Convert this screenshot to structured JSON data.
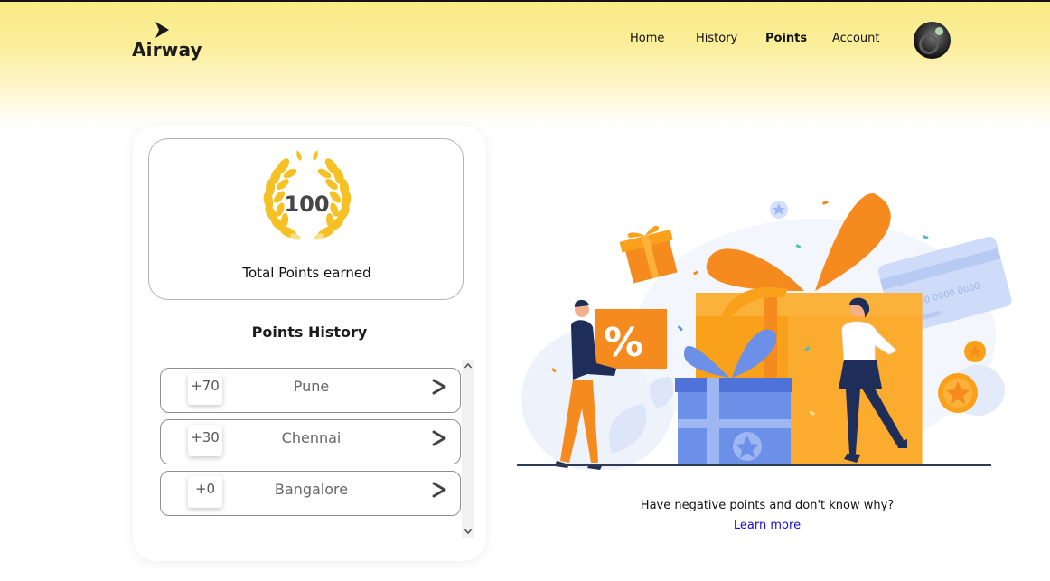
{
  "header": {
    "logo_text": "Airway",
    "nav": [
      {
        "label": "Home",
        "active": false
      },
      {
        "label": "History",
        "active": false
      },
      {
        "label": "Points",
        "active": true
      },
      {
        "label": "Account",
        "active": false
      }
    ]
  },
  "points_card": {
    "total_points": "100",
    "total_label": "Total Points earned",
    "history_title": "Points History",
    "history": [
      {
        "points": "+70",
        "city": "Pune"
      },
      {
        "points": "+30",
        "city": "Chennai"
      },
      {
        "points": "+0",
        "city": "Bangalore"
      }
    ]
  },
  "help": {
    "question": "Have negative points and don't know why?",
    "link": "Learn more"
  },
  "illustration": {
    "card_number": "00 0000 0000"
  },
  "colors": {
    "header_yellow": "#faeb85",
    "laurel_gold": "#f5c125",
    "gift_orange": "#f9a11b",
    "gift_blue": "#6c8fe8",
    "link_blue": "#1a0dcc"
  }
}
